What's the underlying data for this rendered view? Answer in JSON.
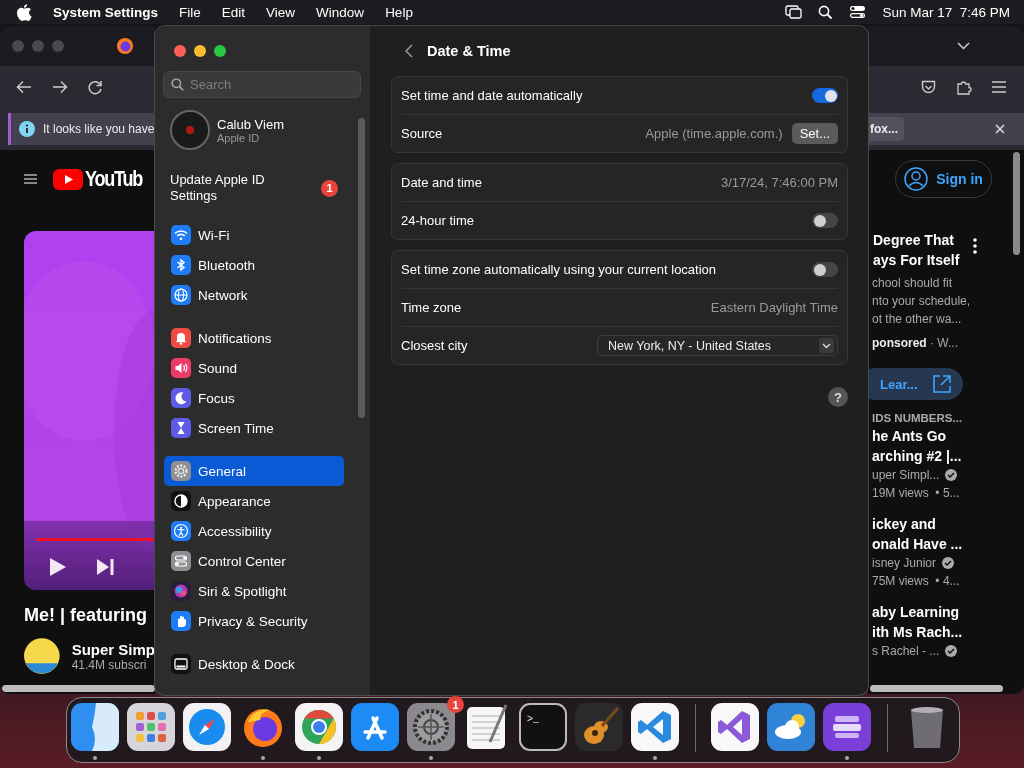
{
  "menu_bar": {
    "app": "System Settings",
    "menus": [
      "File",
      "Edit",
      "View",
      "Window",
      "Help"
    ],
    "clock": "Sun Mar 17  7:46 PM"
  },
  "browser": {
    "left": {
      "notice": "It looks like you have",
      "logo": "YouTub",
      "video_title": "Me! | featuring",
      "channel": "Super Simp",
      "subscribers": "41.4M subscri"
    },
    "right": {
      "notice_button": "fox...",
      "sign_in": "Sign in",
      "ad": {
        "title_lines": [
          "Degree That",
          "ays For Itself"
        ],
        "description_lines": [
          "chool should fit",
          "nto your schedule,",
          "ot the other wa..."
        ],
        "sponsored": "**ponsored** · W...",
        "button": "Lear..."
      },
      "shelf_label": "IDS NUMBERS...",
      "videos": [
        {
          "title_lines": [
            "he Ants Go",
            "arching #2 |..."
          ],
          "channel": "uper Simpl...",
          "verified": true,
          "views": "19M views  • 5..."
        },
        {
          "title_lines": [
            "ickey and",
            "onald Have ..."
          ],
          "channel": "isney Junior",
          "verified": true,
          "views": "75M views  • 4..."
        },
        {
          "title_lines": [
            "aby Learning",
            "ith Ms Rach..."
          ],
          "channel": "s Rachel - ...",
          "verified": true
        }
      ]
    }
  },
  "settings": {
    "sidebar": {
      "search": {
        "placeholder": "Search"
      },
      "account": {
        "name": "Calub Viem",
        "subtitle": "Apple ID"
      },
      "notice": {
        "text": "Update Apple ID Settings",
        "badge": "1"
      },
      "groups": [
        {
          "items": [
            {
              "label": "Wi-Fi",
              "color": "#1f7cf6",
              "selected": false
            },
            {
              "label": "Bluetooth",
              "color": "#1f7cf6",
              "selected": false
            },
            {
              "label": "Network",
              "color": "#1f7cf6",
              "selected": false
            }
          ]
        },
        {
          "items": [
            {
              "label": "Notifications",
              "color": "#ee4b45",
              "selected": false
            },
            {
              "label": "Sound",
              "color": "#ec3c67",
              "selected": false
            },
            {
              "label": "Focus",
              "color": "#5e5ce6",
              "selected": false
            },
            {
              "label": "Screen Time",
              "color": "#5e5ce6",
              "selected": false
            }
          ]
        },
        {
          "items": [
            {
              "label": "General",
              "color": "#8e8e93",
              "selected": true
            },
            {
              "label": "Appearance",
              "color": "#111111",
              "selected": false
            },
            {
              "label": "Accessibility",
              "color": "#1f7cf6",
              "selected": false
            },
            {
              "label": "Control Center",
              "color": "#8e8e93",
              "selected": false
            },
            {
              "label": "Siri & Spotlight",
              "color": "#2a1f3a",
              "selected": false
            },
            {
              "label": "Privacy & Security",
              "color": "#1f7cf6",
              "selected": false
            }
          ]
        },
        {
          "items": [
            {
              "label": "Desktop & Dock",
              "color": "#111111",
              "selected": false
            }
          ]
        }
      ]
    },
    "panel": {
      "title": "Date & Time",
      "groups": [
        {
          "rows": [
            {
              "kind": "toggle",
              "label": "Set time and date automatically",
              "on": true
            },
            {
              "kind": "value_button",
              "label": "Source",
              "value": "Apple (time.apple.com.)",
              "button": "Set..."
            }
          ]
        },
        {
          "rows": [
            {
              "kind": "value",
              "label": "Date and time",
              "value": "3/17/24, 7:46:00 PM"
            },
            {
              "kind": "toggle",
              "label": "24-hour time",
              "on": false
            }
          ]
        },
        {
          "rows": [
            {
              "kind": "toggle",
              "label": "Set time zone automatically using your current location",
              "on": false
            },
            {
              "kind": "value",
              "label": "Time zone",
              "value": "Eastern Daylight Time"
            },
            {
              "kind": "popup",
              "label": "Closest city",
              "value": "New York, NY - United States"
            }
          ]
        }
      ],
      "help": "?"
    }
  },
  "dock": {
    "sections": [
      {
        "items": [
          {
            "kind": "finder",
            "running": true
          },
          {
            "kind": "launchpad",
            "running": false
          },
          {
            "kind": "safari",
            "running": false
          },
          {
            "kind": "firefox",
            "running": true
          },
          {
            "kind": "chrome",
            "running": true
          },
          {
            "kind": "appstore",
            "running": false
          },
          {
            "kind": "settings",
            "running": true,
            "badge": "1"
          },
          {
            "kind": "textedit",
            "running": false
          },
          {
            "kind": "terminal",
            "running": false,
            "label": ">_"
          },
          {
            "kind": "garageband",
            "running": false
          },
          {
            "kind": "vscode",
            "running": true
          }
        ]
      },
      {
        "items": [
          {
            "kind": "visualstudio",
            "running": false
          },
          {
            "kind": "weather",
            "running": false
          },
          {
            "kind": "configurator",
            "running": true
          }
        ]
      },
      {
        "items": [
          {
            "kind": "trash",
            "running": false
          }
        ]
      }
    ]
  }
}
